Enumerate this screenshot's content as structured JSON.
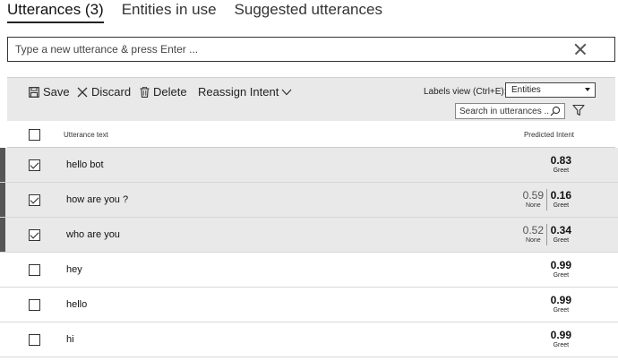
{
  "tabs": [
    {
      "label": "Utterances (3)",
      "active": true
    },
    {
      "label": "Entities in use",
      "active": false
    },
    {
      "label": "Suggested utterances",
      "active": false
    }
  ],
  "new_utterance": {
    "placeholder": "Type a new utterance & press Enter ..."
  },
  "toolbar": {
    "save_label": "Save",
    "discard_label": "Discard",
    "delete_label": "Delete",
    "reassign_label": "Reassign Intent",
    "labels_view_label": "Labels view (Ctrl+E):",
    "labels_view_value": "Entities",
    "search_placeholder": "Search in utterances ..."
  },
  "table": {
    "col_text": "Utterance text",
    "col_intent": "Predicted Intent",
    "rows": [
      {
        "text": "hello bot",
        "checked": true,
        "score": "0.83",
        "intent": "Greet"
      },
      {
        "text": "how are you ?",
        "checked": true,
        "score": "0.16",
        "intent": "Greet",
        "alt_score": "0.59",
        "alt_intent": "None"
      },
      {
        "text": "who are you",
        "checked": true,
        "score": "0.34",
        "intent": "Greet",
        "alt_score": "0.52",
        "alt_intent": "None"
      },
      {
        "text": "hey",
        "checked": false,
        "score": "0.99",
        "intent": "Greet"
      },
      {
        "text": "hello",
        "checked": false,
        "score": "0.99",
        "intent": "Greet"
      },
      {
        "text": "hi",
        "checked": false,
        "score": "0.99",
        "intent": "Greet"
      }
    ]
  }
}
